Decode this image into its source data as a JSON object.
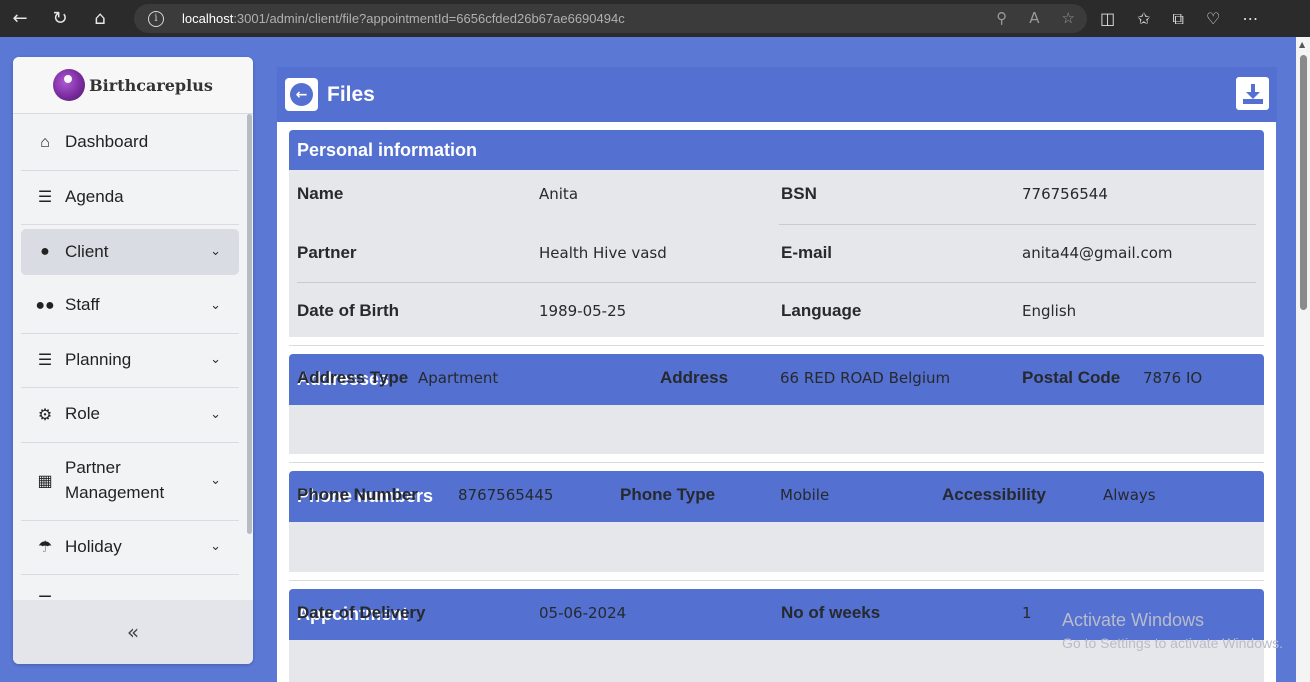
{
  "browser": {
    "url_host": "localhost",
    "url_rest": ":3001/admin/client/file?appointmentId=6656cfded26b67ae6690494c"
  },
  "sidebar": {
    "logo_text": "Birthcareplus",
    "items": [
      {
        "label": "Dashboard",
        "icon": "home-icon"
      },
      {
        "label": "Agenda",
        "icon": "list-icon"
      },
      {
        "label": "Client",
        "icon": "person-icon"
      },
      {
        "label": "Staff",
        "icon": "group-icon"
      },
      {
        "label": "Planning",
        "icon": "list-icon"
      },
      {
        "label": "Role",
        "icon": "user-gear-icon"
      },
      {
        "label": "Partner Management",
        "icon": "building-icon"
      },
      {
        "label": "Holiday",
        "icon": "beach-umbrella-icon"
      }
    ],
    "collapse_label": "«"
  },
  "header": {
    "title": "Files"
  },
  "personal": {
    "title": "Personal information",
    "name_label": "Name",
    "name_value": "Anita",
    "bsn_label": "BSN",
    "bsn_value": "776756544",
    "partner_label": "Partner",
    "partner_value": "Health Hive vasd",
    "email_label": "E-mail",
    "email_value": "anita44@gmail.com",
    "dob_label": "Date of Birth",
    "dob_value": "1989-05-25",
    "language_label": "Language",
    "language_value": "English"
  },
  "addresses": {
    "title": "Addresses",
    "type_label": "Address Type",
    "type_value": "Apartment",
    "address_label": "Address",
    "address_value": "66 RED ROAD Belgium",
    "postal_label": "Postal Code",
    "postal_value": "7876 IO"
  },
  "phones": {
    "title": "Phone numbers",
    "number_label": "Phone Number",
    "number_value": "8767565445",
    "type_label": "Phone Type",
    "type_value": "Mobile",
    "access_label": "Accessibility",
    "access_value": "Always"
  },
  "appointment": {
    "title": "Appointment",
    "delivery_label": "Date of Delivery",
    "delivery_value": "05-06-2024",
    "weeks_label": "No of weeks",
    "weeks_value": "1"
  },
  "watermark": {
    "title": "Activate Windows",
    "subtitle": "Go to Settings to activate Windows."
  }
}
